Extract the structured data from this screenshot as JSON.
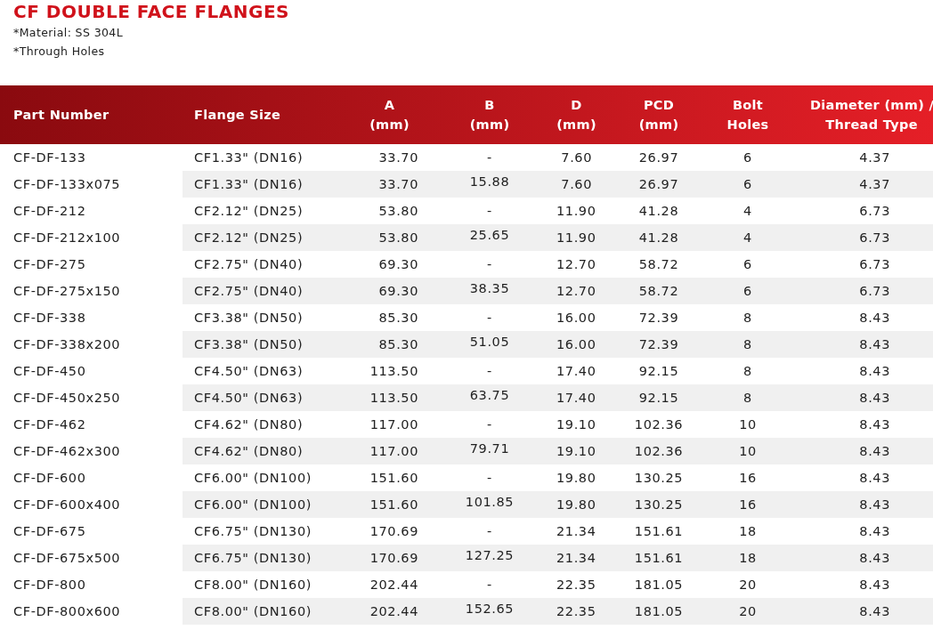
{
  "title": "CF DOUBLE FACE FLANGES",
  "notes": [
    "*Material: SS 304L",
    "*Through Holes"
  ],
  "table": {
    "columns": [
      {
        "lines": [
          "Part Number"
        ]
      },
      {
        "lines": [
          "Flange Size"
        ]
      },
      {
        "lines": [
          "A",
          "(mm)"
        ]
      },
      {
        "lines": [
          "B",
          "(mm)"
        ]
      },
      {
        "lines": [
          "D",
          "(mm)"
        ]
      },
      {
        "lines": [
          "PCD",
          "(mm)"
        ]
      },
      {
        "lines": [
          "Bolt",
          "Holes"
        ]
      },
      {
        "lines": [
          "Diameter (mm) /",
          "Thread Type"
        ]
      }
    ],
    "rows": [
      [
        "CF-DF-133",
        "CF1.33\" (DN16)",
        "33.70",
        "-",
        "7.60",
        "26.97",
        "6",
        "4.37"
      ],
      [
        "CF-DF-133x075",
        "CF1.33\" (DN16)",
        "33.70",
        "15.88",
        "7.60",
        "26.97",
        "6",
        "4.37"
      ],
      [
        "CF-DF-212",
        "CF2.12\" (DN25)",
        "53.80",
        "-",
        "11.90",
        "41.28",
        "4",
        "6.73"
      ],
      [
        "CF-DF-212x100",
        "CF2.12\" (DN25)",
        "53.80",
        "25.65",
        "11.90",
        "41.28",
        "4",
        "6.73"
      ],
      [
        "CF-DF-275",
        "CF2.75\" (DN40)",
        "69.30",
        "-",
        "12.70",
        "58.72",
        "6",
        "6.73"
      ],
      [
        "CF-DF-275x150",
        "CF2.75\" (DN40)",
        "69.30",
        "38.35",
        "12.70",
        "58.72",
        "6",
        "6.73"
      ],
      [
        "CF-DF-338",
        "CF3.38\" (DN50)",
        "85.30",
        "-",
        "16.00",
        "72.39",
        "8",
        "8.43"
      ],
      [
        "CF-DF-338x200",
        "CF3.38\" (DN50)",
        "85.30",
        "51.05",
        "16.00",
        "72.39",
        "8",
        "8.43"
      ],
      [
        "CF-DF-450",
        "CF4.50\" (DN63)",
        "113.50",
        "-",
        "17.40",
        "92.15",
        "8",
        "8.43"
      ],
      [
        "CF-DF-450x250",
        "CF4.50\" (DN63)",
        "113.50",
        "63.75",
        "17.40",
        "92.15",
        "8",
        "8.43"
      ],
      [
        "CF-DF-462",
        "CF4.62\" (DN80)",
        "117.00",
        "-",
        "19.10",
        "102.36",
        "10",
        "8.43"
      ],
      [
        "CF-DF-462x300",
        "CF4.62\" (DN80)",
        "117.00",
        "79.71",
        "19.10",
        "102.36",
        "10",
        "8.43"
      ],
      [
        "CF-DF-600",
        "CF6.00\" (DN100)",
        "151.60",
        "-",
        "19.80",
        "130.25",
        "16",
        "8.43"
      ],
      [
        "CF-DF-600x400",
        "CF6.00\" (DN100)",
        "151.60",
        "101.85",
        "19.80",
        "130.25",
        "16",
        "8.43"
      ],
      [
        "CF-DF-675",
        "CF6.75\" (DN130)",
        "170.69",
        "-",
        "21.34",
        "151.61",
        "18",
        "8.43"
      ],
      [
        "CF-DF-675x500",
        "CF6.75\" (DN130)",
        "170.69",
        "127.25",
        "21.34",
        "151.61",
        "18",
        "8.43"
      ],
      [
        "CF-DF-800",
        "CF8.00\" (DN160)",
        "202.44",
        "-",
        "22.35",
        "181.05",
        "20",
        "8.43"
      ],
      [
        "CF-DF-800x600",
        "CF8.00\" (DN160)",
        "202.44",
        "152.65",
        "22.35",
        "181.05",
        "20",
        "8.43"
      ]
    ]
  }
}
